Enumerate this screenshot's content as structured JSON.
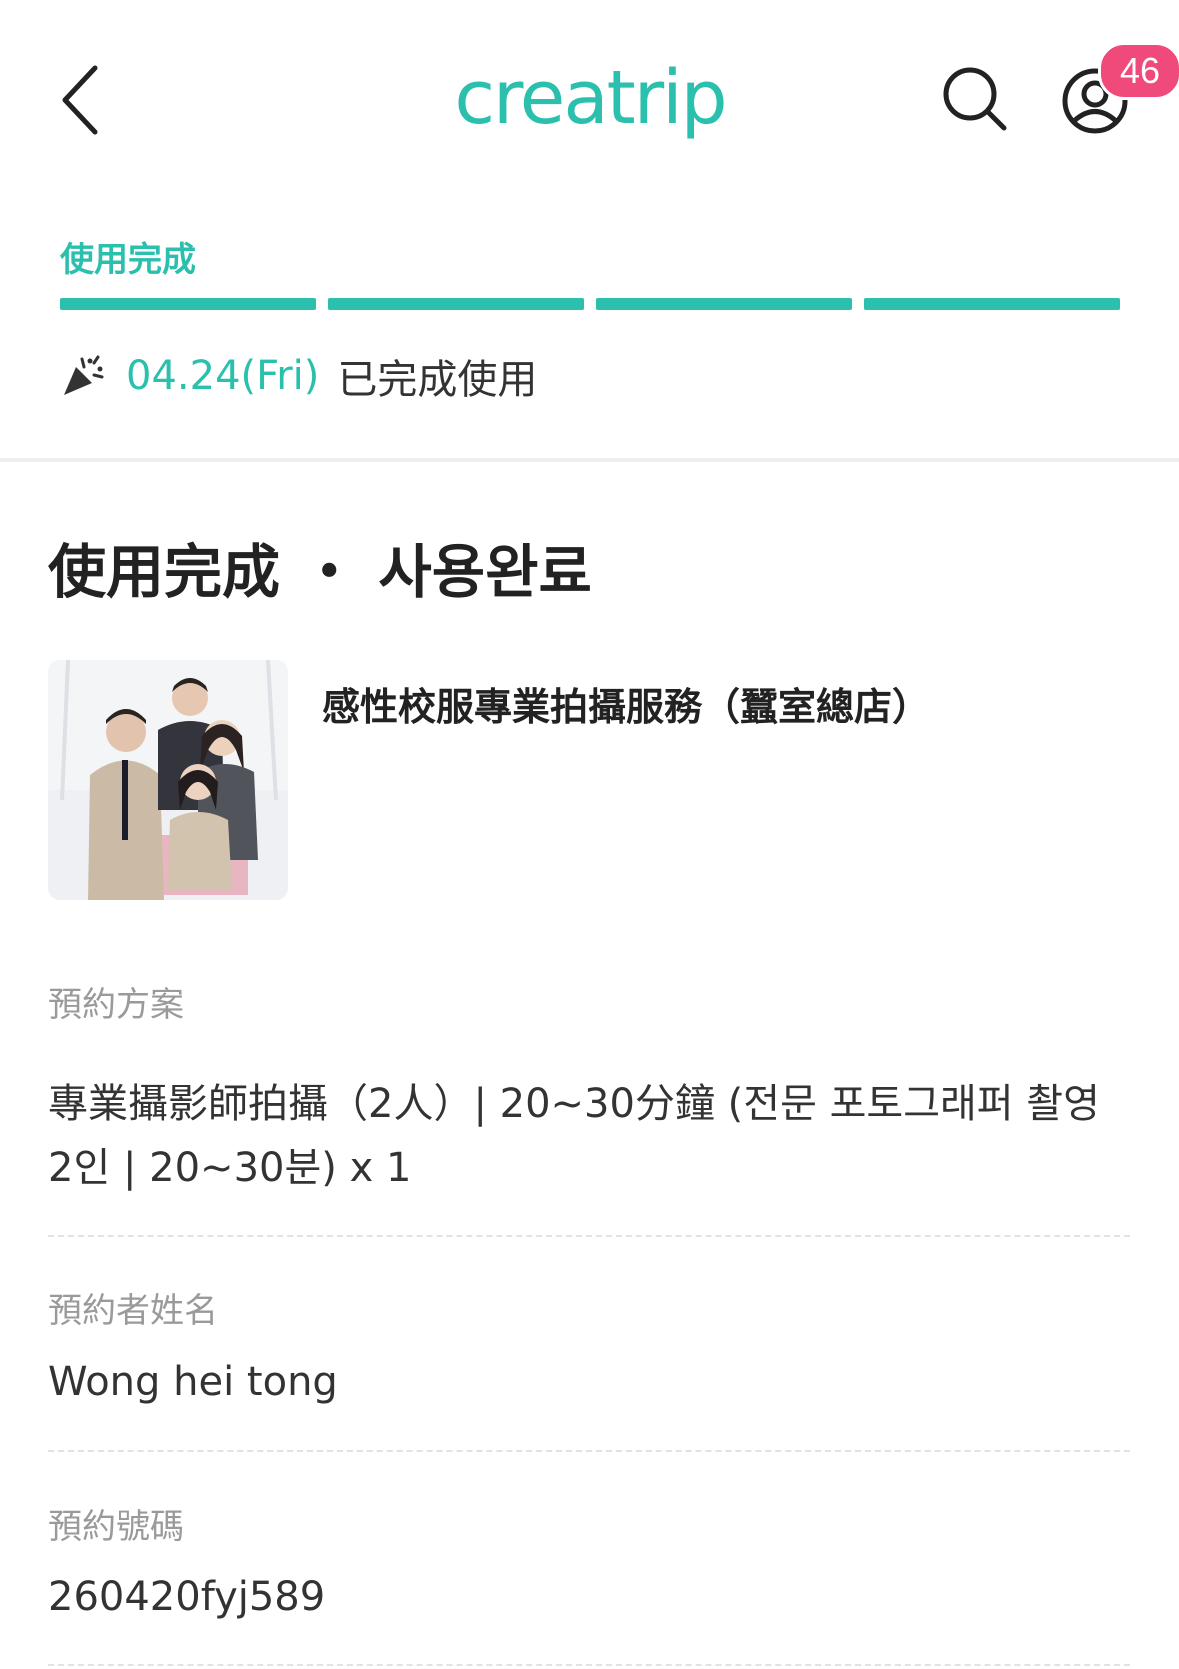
{
  "header": {
    "logo_text": "creatrip",
    "notification_count": "46",
    "accent_color": "#2bbfad",
    "badge_color": "#f04a7a",
    "icons": {
      "back": "chevron-left-icon",
      "search": "search-icon",
      "profile": "user-circle-icon"
    }
  },
  "status": {
    "label": "使用完成",
    "progress_steps_total": 4,
    "progress_steps_completed": 4,
    "date": "04.24(Fri)",
    "completed_text": "已完成使用",
    "icon": "party-popper-icon"
  },
  "booking": {
    "title": "使用完成 ・ 사용완료",
    "product_name": "感性校服專業拍攝服務（蠶室總店）",
    "thumbnail_alt": "four people in school uniforms",
    "fields": [
      {
        "label": "預約方案",
        "value": "專業攝影師拍攝（2人）| 20~30分鐘 (전문 포토그래퍼 촬영 2인 | 20~30분) x 1"
      },
      {
        "label": "預約者姓名",
        "value": "Wong hei tong"
      },
      {
        "label": "預約號碼",
        "value": "260420fyj589"
      }
    ]
  }
}
